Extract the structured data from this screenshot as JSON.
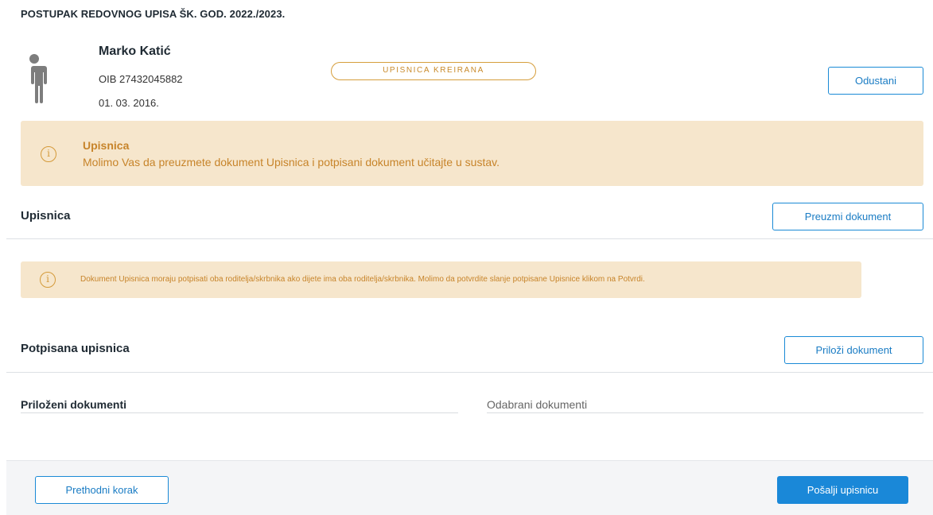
{
  "page": {
    "title": "POSTUPAK REDOVNOG UPISA ŠK. GOD. 2022./2023."
  },
  "student": {
    "name": "Marko Katić",
    "oib": "OIB 27432045882",
    "dob": "01. 03. 2016.",
    "status": "UPISNICA KREIRANA",
    "avatar_icon": "person-icon"
  },
  "actions": {
    "cancel_label": "Odustani"
  },
  "alert_main": {
    "icon": "info-icon",
    "title": "Upisnica",
    "text": "Molimo Vas da preuzmete dokument Upisnica i potpisani dokument učitajte u sustav."
  },
  "section_upisnica": {
    "title": "Upisnica",
    "download_label": "Preuzmi dokument"
  },
  "alert_note": {
    "icon": "info-icon",
    "text": "Dokument Upisnica moraju potpisati oba roditelja/skrbnika ako dijete ima oba roditelja/skrbnika. Molimo da potvrdite slanje potpisane Upisnice klikom na Potvrdi."
  },
  "section_signed": {
    "title": "Potpisana upisnica",
    "attach_label": "Priloži dokument",
    "attached_label": "Priloženi dokumenti",
    "selected_label": "Odabrani dokumenti"
  },
  "footer": {
    "prev_label": "Prethodni korak",
    "send_label": "Pošalji upisnicu"
  },
  "colors": {
    "accent": "#1a88d8",
    "warning_bg": "#f6e6cc",
    "warning_text": "#c7842a",
    "badge_border": "#d69e3c"
  }
}
